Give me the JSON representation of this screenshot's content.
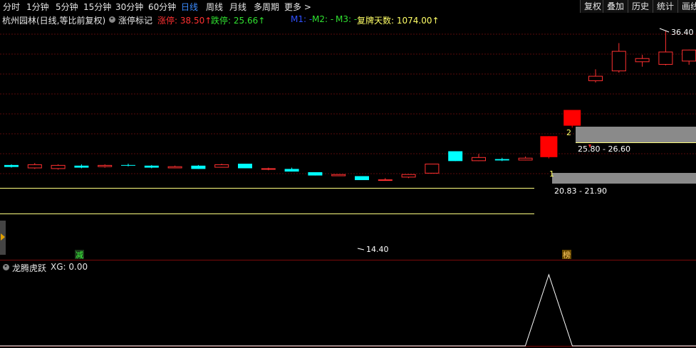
{
  "toolbar": {
    "timeframes": [
      "分时",
      "1分钟",
      "5分钟",
      "15分钟",
      "30分钟",
      "60分钟",
      "日线",
      "周线",
      "月线",
      "多周期",
      "更多 >"
    ],
    "active": "日线",
    "right_buttons": [
      "复权",
      "叠加",
      "历史",
      "统计",
      "画线"
    ]
  },
  "info": {
    "stock": "杭州园林",
    "mode": "(日线,等比前复权)",
    "indicator_name": "涨停标记",
    "limit_up_label": "涨停: 38.50↑",
    "limit_down_label": "跌停: 25.66↑",
    "m1": "M1: -",
    "m2": "M2: -",
    "m3": "M3: -",
    "resume_days": "复牌天数: 1074.00↑"
  },
  "colors": {
    "up": "#ff3030",
    "down": "#00ffff",
    "limit": "#ff0000",
    "yellow": "#ffff66",
    "grid": "#5a0a0a",
    "zone": "#8a8a8a"
  },
  "chart_data": {
    "type": "candlestick",
    "price_labels": {
      "high": "36.40",
      "low": "14.40"
    },
    "zones": [
      {
        "index": "1",
        "range": "20.83 - 21.90"
      },
      {
        "index": "2",
        "range": "25.80 - 26.60"
      }
    ],
    "markers": {
      "reduce": "减",
      "list": "榜"
    },
    "candles": [
      {
        "o": 15.9,
        "c": 15.6,
        "h": 16.0,
        "l": 15.5
      },
      {
        "o": 15.4,
        "c": 16.0,
        "h": 16.2,
        "l": 15.3
      },
      {
        "o": 15.3,
        "c": 15.9,
        "h": 16.0,
        "l": 15.2
      },
      {
        "o": 15.8,
        "c": 15.5,
        "h": 16.0,
        "l": 15.4
      },
      {
        "o": 15.6,
        "c": 15.9,
        "h": 16.0,
        "l": 15.5
      },
      {
        "o": 15.9,
        "c": 15.8,
        "h": 16.1,
        "l": 15.7
      },
      {
        "o": 15.8,
        "c": 15.5,
        "h": 15.9,
        "l": 15.4
      },
      {
        "o": 15.4,
        "c": 15.7,
        "h": 15.8,
        "l": 15.4
      },
      {
        "o": 15.8,
        "c": 15.3,
        "h": 15.9,
        "l": 15.3
      },
      {
        "o": 15.5,
        "c": 16.0,
        "h": 16.1,
        "l": 15.5
      },
      {
        "o": 16.1,
        "c": 15.4,
        "h": 16.1,
        "l": 15.4
      },
      {
        "o": 15.2,
        "c": 15.4,
        "h": 15.5,
        "l": 15.1
      },
      {
        "o": 15.3,
        "c": 14.9,
        "h": 15.5,
        "l": 14.9
      },
      {
        "o": 14.8,
        "c": 14.3,
        "h": 14.8,
        "l": 14.3
      },
      {
        "o": 14.2,
        "c": 14.5,
        "h": 14.5,
        "l": 14.2
      },
      {
        "o": 14.2,
        "c": 13.6,
        "h": 14.2,
        "l": 13.6
      },
      {
        "o": 13.7,
        "c": 13.7,
        "h": 13.9,
        "l": 13.5
      },
      {
        "o": 14.0,
        "c": 14.5,
        "h": 14.5,
        "l": 13.9
      },
      {
        "o": 14.6,
        "c": 16.1,
        "h": 16.1,
        "l": 14.6
      },
      {
        "o": 18.0,
        "c": 16.5,
        "h": 18.0,
        "l": 16.5
      },
      {
        "o": 16.5,
        "c": 17.1,
        "h": 17.6,
        "l": 16.5
      },
      {
        "o": 16.8,
        "c": 16.6,
        "h": 17.0,
        "l": 16.5
      },
      {
        "o": 16.6,
        "c": 17.0,
        "h": 17.2,
        "l": 16.6
      },
      {
        "o": 17.1,
        "c": 20.3,
        "h": 20.3,
        "l": 16.9
      },
      {
        "o": 21.9,
        "c": 24.3,
        "h": 24.3,
        "l": 21.6
      },
      {
        "o": 28.7,
        "c": 29.5,
        "h": 30.5,
        "l": 28.5
      },
      {
        "o": 30.2,
        "c": 33.3,
        "h": 34.5,
        "l": 30.0
      },
      {
        "o": 31.6,
        "c": 32.2,
        "h": 32.7,
        "l": 30.9
      },
      {
        "o": 31.2,
        "c": 33.2,
        "h": 36.4,
        "l": 31.1
      },
      {
        "o": 31.7,
        "c": 33.5,
        "h": 33.5,
        "l": 31.2
      }
    ],
    "sub_indicator": {
      "name": "龙腾虎跃",
      "value_label": "XG: 0.00",
      "signal_index": 23
    }
  }
}
